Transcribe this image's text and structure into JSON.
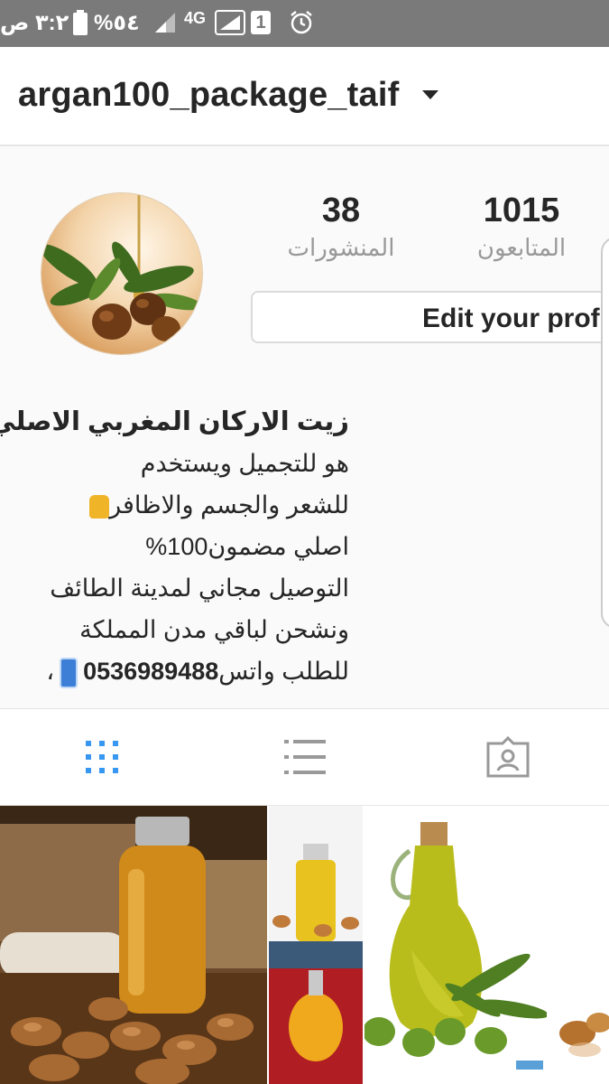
{
  "status_bar": {
    "time": "٣:٢٠ ص",
    "battery": "%٥٤",
    "network": "4G",
    "sim": "1"
  },
  "header": {
    "username": "argan100_package_taif"
  },
  "profile": {
    "posts_count": "38",
    "posts_label": "المنشورات",
    "followers_count": "1015",
    "followers_label": "المتابعون",
    "edit_button": "Edit your profile"
  },
  "bio": {
    "title": "زيت الاركان المغربي الاصلي",
    "line1": "هو للتجميل ويستخدم",
    "line2": "للشعر والجسم والاظافر",
    "line3": "اصلي مضمون100%",
    "line4": "التوصيل مجاني لمدينة الطائف",
    "line5": "ونشحن لباقي مدن المملكة",
    "line6_text": "للطلب واتس",
    "line6_phone": "0536989488",
    "line6_tail": "،"
  },
  "tabs": [
    {
      "name": "grid",
      "icon": "grid-icon",
      "active": true
    },
    {
      "name": "list",
      "icon": "list-icon",
      "active": false
    },
    {
      "name": "tagged",
      "icon": "tagged-person-icon",
      "active": false
    }
  ],
  "colors": {
    "accent": "#3897f0",
    "status_bar": "#7a7a7a",
    "text": "#262626",
    "muted": "#999999"
  }
}
